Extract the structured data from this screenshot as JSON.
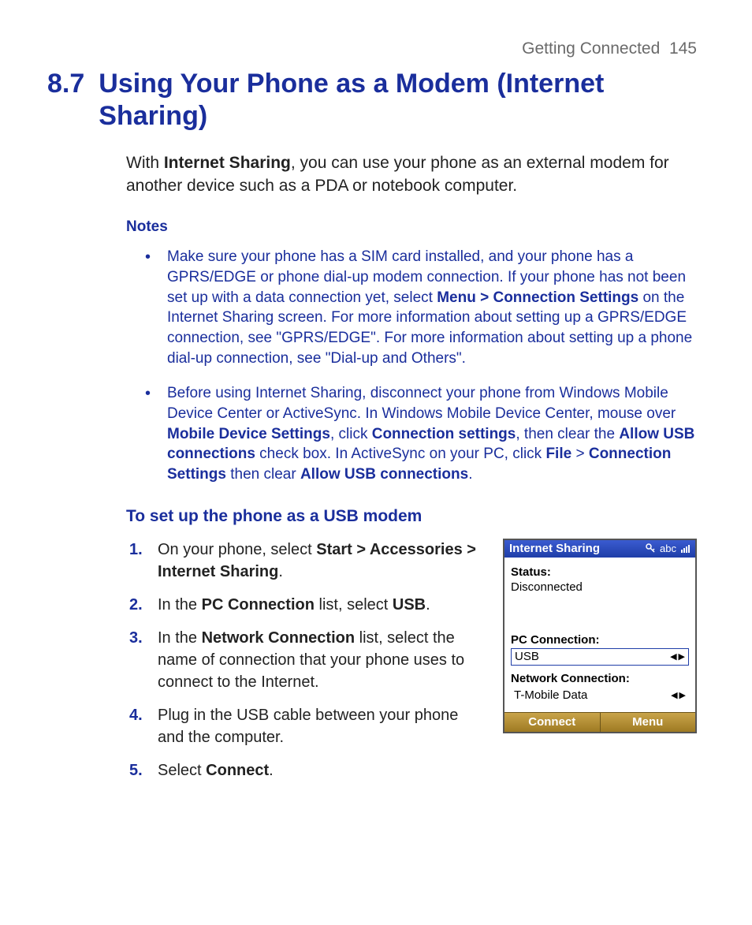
{
  "runningHead": {
    "chapter": "Getting Connected",
    "page": "145"
  },
  "section": {
    "number": "8.7",
    "title": "Using Your Phone as a Modem (Internet Sharing)"
  },
  "intro": {
    "pre": "With ",
    "bold1": "Internet Sharing",
    "post": ", you can use your phone as an external modem for another device such as a PDA or notebook computer."
  },
  "notesHead": "Notes",
  "notes": {
    "n1": {
      "a": "Make sure your phone has a SIM card installed, and your phone has a GPRS/EDGE or phone dial-up modem connection. If your phone has not been set up with a data connection yet, select ",
      "b1": "Menu > Connection Settings",
      "b": " on the Internet Sharing screen. For more information about setting up a GPRS/EDGE connection, see \"GPRS/EDGE\". For more information about setting up a phone dial-up connection, see \"Dial-up and Others\"."
    },
    "n2": {
      "a": "Before using Internet Sharing, disconnect your phone from Windows Mobile Device Center or ActiveSync. In Windows Mobile Device Center, mouse over ",
      "b1": "Mobile Device Settings",
      "b": ", click ",
      "b2": "Connection settings",
      "c": ", then clear the ",
      "b3": "Allow USB connections",
      "d": " check box. In ActiveSync on your PC, click ",
      "b4": "File",
      "e": " > ",
      "b5": "Connection Settings",
      "f": " then clear ",
      "b6": "Allow USB connections",
      "g": "."
    }
  },
  "subhead": "To set up the phone as a USB modem",
  "steps": {
    "s1": {
      "a": "On your phone, select ",
      "b1": "Start > Accessories > Internet Sharing",
      "b": "."
    },
    "s2": {
      "a": "In the ",
      "b1": "PC Connection",
      "b": " list, select ",
      "b2": "USB",
      "c": "."
    },
    "s3": {
      "a": "In the ",
      "b1": "Network Connection",
      "b": " list, select the name of connection that your phone uses to connect to the Internet."
    },
    "s4": {
      "a": "Plug in the USB cable between your phone and the computer."
    },
    "s5": {
      "a": "Select ",
      "b1": "Connect",
      "b": "."
    }
  },
  "phone": {
    "title": "Internet Sharing",
    "icons": {
      "abc": "abc"
    },
    "statusLabel": "Status:",
    "statusValue": "Disconnected",
    "pcConnLabel": "PC Connection:",
    "pcConnValue": "USB",
    "netConnLabel": "Network Connection:",
    "netConnValue": "T-Mobile Data",
    "leftSoft": "Connect",
    "rightSoft": "Menu",
    "arrowLeft": "◀",
    "arrowRight": "▶"
  }
}
